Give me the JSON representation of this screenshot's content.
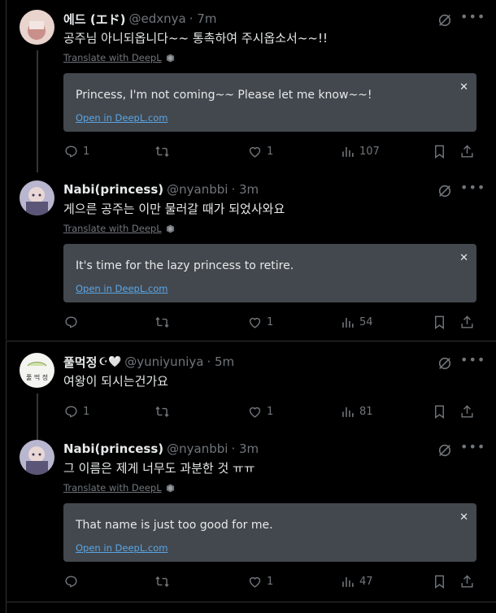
{
  "tweets": [
    {
      "name": "에드 (エド)",
      "handle": "@edxnya",
      "time": "· 7m",
      "emoji": "",
      "text": "공주님 아니되옵니다~~ 통촉하여 주시옵소서~~!!",
      "translate_label": "Translate with DeepL",
      "translation": "Princess, I'm not coming~~ Please let me know~~!",
      "open_label": "Open in DeepL.com",
      "replies": "1",
      "retweets": "",
      "likes": "1",
      "views": "107"
    },
    {
      "name": "Nabi(princess)",
      "handle": "@nyanbbi",
      "time": "· 3m",
      "emoji": "",
      "text": "게으른 공주는 이만 물러갈 때가 되었사와요",
      "translate_label": "Translate with DeepL",
      "translation": "It's time for the lazy princess to retire.",
      "open_label": "Open in DeepL.com",
      "replies": "",
      "retweets": "",
      "likes": "1",
      "views": "54"
    },
    {
      "name": "풀먹정",
      "handle": "@yuniyuniya",
      "time": "· 5m",
      "emoji": "☪🤍",
      "text": "여왕이 되시는건가요",
      "replies": "1",
      "retweets": "",
      "likes": "1",
      "views": "81"
    },
    {
      "name": "Nabi(princess)",
      "handle": "@nyanbbi",
      "time": "· 3m",
      "emoji": "",
      "text": "그 이름은 제게 너무도 과분한 것 ㅠㅠ",
      "translate_label": "Translate with DeepL",
      "translation": "That name is just too good for me.",
      "open_label": "Open in DeepL.com",
      "replies": "",
      "retweets": "",
      "likes": "1",
      "views": "47"
    }
  ],
  "colors": {
    "background": "#000000",
    "text": "#e7e9ea",
    "muted": "#71767b",
    "translation_box": "#43484e",
    "link": "#5aa6e6"
  },
  "icons": [
    "grok-icon",
    "more-icon",
    "reply-icon",
    "retweet-icon",
    "like-icon",
    "views-icon",
    "bookmark-icon",
    "share-icon",
    "deepl-icon",
    "close-icon"
  ]
}
